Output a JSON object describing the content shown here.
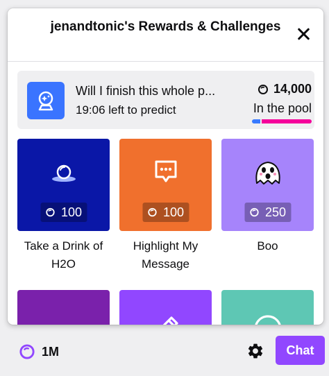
{
  "popup": {
    "title": "jenandtonic's Rewards & Challenges",
    "close_icon": "close-icon"
  },
  "prediction": {
    "icon": "prediction-icon",
    "title": "Will I finish this whole p...",
    "subtitle": "19:06 left to predict",
    "amount": "14,000",
    "pool_label": "In the pool",
    "bar": {
      "blue_fraction": 0.14,
      "blue_color": "#387aff",
      "pink_color": "#f5009b"
    }
  },
  "rewards": [
    {
      "name": "Take a Drink of H2O",
      "cost": "100",
      "color": "#0a17a7",
      "icon": "water-drop-icon"
    },
    {
      "name": "Highlight My Message",
      "cost": "100",
      "color": "#f0702d",
      "icon": "highlight-message-icon"
    },
    {
      "name": "Boo",
      "cost": "250",
      "color": "#a684fb",
      "icon": "ghost-icon"
    },
    {
      "name": "",
      "cost": "",
      "color": "#7a21ab",
      "icon": "unlock-icon"
    },
    {
      "name": "",
      "cost": "",
      "color": "#9147ff",
      "icon": "pencil-icon"
    },
    {
      "name": "",
      "cost": "",
      "color": "#5ec7b4",
      "icon": "smiley-icon"
    }
  ],
  "footer": {
    "points": "1M",
    "settings_icon": "gear-icon",
    "chat_label": "Chat"
  },
  "colors": {
    "accent": "#9147ff",
    "channel_points_icon": "#9147ff"
  }
}
